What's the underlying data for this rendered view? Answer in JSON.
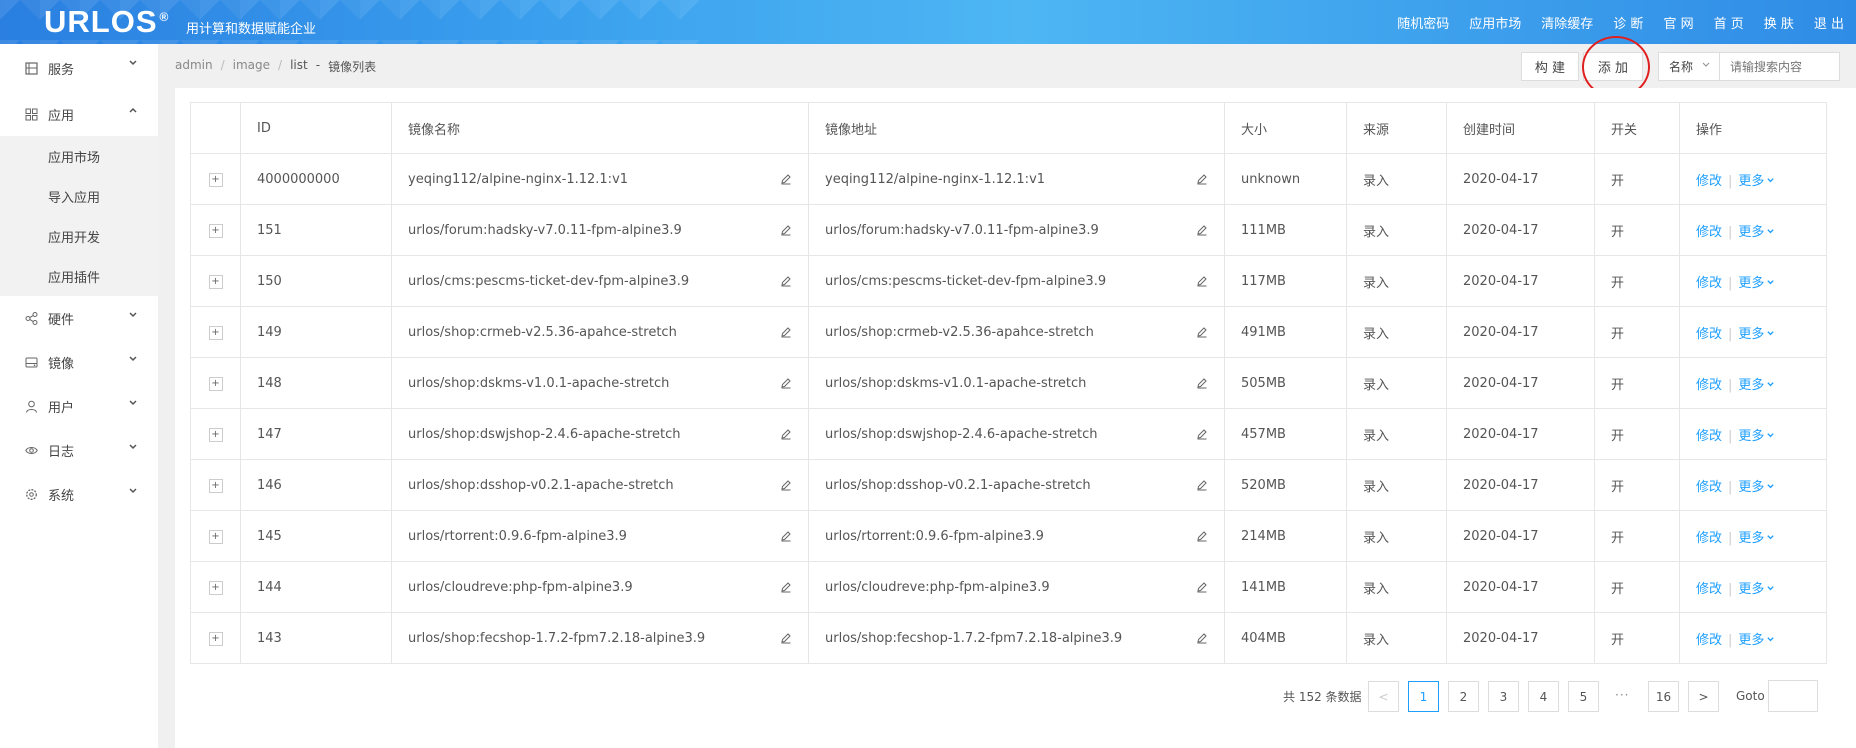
{
  "header": {
    "logo": "URLOS",
    "logo_mark": "®",
    "slogan": "用计算和数据赋能企业",
    "nav": [
      "随机密码",
      "应用市场",
      "清除缓存",
      "诊 断",
      "官 网",
      "首 页",
      "换 肤",
      "退 出"
    ]
  },
  "sidebar": {
    "items": [
      {
        "label": "服务",
        "icon": "server-icon"
      },
      {
        "label": "应用",
        "icon": "grid-icon"
      },
      {
        "label": "硬件",
        "icon": "share-icon"
      },
      {
        "label": "镜像",
        "icon": "disk-icon"
      },
      {
        "label": "用户",
        "icon": "user-icon"
      },
      {
        "label": "日志",
        "icon": "eye-icon"
      },
      {
        "label": "系统",
        "icon": "gear-icon"
      }
    ],
    "app_sub": [
      "应用市场",
      "导入应用",
      "应用开发",
      "应用插件"
    ]
  },
  "breadcrumb": {
    "a": "admin",
    "b": "image",
    "c": "list",
    "sep": "/",
    "dash": "-",
    "title": "镜像列表"
  },
  "toolbar": {
    "build": "构 建",
    "add": "添 加",
    "select_value": "名称",
    "search_placeholder": "请输搜索内容"
  },
  "table": {
    "columns": [
      "ID",
      "镜像名称",
      "镜像地址",
      "大小",
      "来源",
      "创建时间",
      "开关",
      "操作"
    ],
    "rows": [
      {
        "id": "4000000000",
        "name": "yeqing112/alpine-nginx-1.12.1:v1",
        "addr": "yeqing112/alpine-nginx-1.12.1:v1",
        "size": "unknown",
        "source": "录入",
        "created": "2020-04-17",
        "switch": "开"
      },
      {
        "id": "151",
        "name": "urlos/forum:hadsky-v7.0.11-fpm-alpine3.9",
        "addr": "urlos/forum:hadsky-v7.0.11-fpm-alpine3.9",
        "size": "111MB",
        "source": "录入",
        "created": "2020-04-17",
        "switch": "开"
      },
      {
        "id": "150",
        "name": "urlos/cms:pescms-ticket-dev-fpm-alpine3.9",
        "addr": "urlos/cms:pescms-ticket-dev-fpm-alpine3.9",
        "size": "117MB",
        "source": "录入",
        "created": "2020-04-17",
        "switch": "开"
      },
      {
        "id": "149",
        "name": "urlos/shop:crmeb-v2.5.36-apahce-stretch",
        "addr": "urlos/shop:crmeb-v2.5.36-apahce-stretch",
        "size": "491MB",
        "source": "录入",
        "created": "2020-04-17",
        "switch": "开"
      },
      {
        "id": "148",
        "name": "urlos/shop:dskms-v1.0.1-apache-stretch",
        "addr": "urlos/shop:dskms-v1.0.1-apache-stretch",
        "size": "505MB",
        "source": "录入",
        "created": "2020-04-17",
        "switch": "开"
      },
      {
        "id": "147",
        "name": "urlos/shop:dswjshop-2.4.6-apache-stretch",
        "addr": "urlos/shop:dswjshop-2.4.6-apache-stretch",
        "size": "457MB",
        "source": "录入",
        "created": "2020-04-17",
        "switch": "开"
      },
      {
        "id": "146",
        "name": "urlos/shop:dsshop-v0.2.1-apache-stretch",
        "addr": "urlos/shop:dsshop-v0.2.1-apache-stretch",
        "size": "520MB",
        "source": "录入",
        "created": "2020-04-17",
        "switch": "开"
      },
      {
        "id": "145",
        "name": "urlos/rtorrent:0.9.6-fpm-alpine3.9",
        "addr": "urlos/rtorrent:0.9.6-fpm-alpine3.9",
        "size": "214MB",
        "source": "录入",
        "created": "2020-04-17",
        "switch": "开"
      },
      {
        "id": "144",
        "name": "urlos/cloudreve:php-fpm-alpine3.9",
        "addr": "urlos/cloudreve:php-fpm-alpine3.9",
        "size": "141MB",
        "source": "录入",
        "created": "2020-04-17",
        "switch": "开"
      },
      {
        "id": "143",
        "name": "urlos/shop:fecshop-1.7.2-fpm7.2.18-alpine3.9",
        "addr": "urlos/shop:fecshop-1.7.2-fpm7.2.18-alpine3.9",
        "size": "404MB",
        "source": "录入",
        "created": "2020-04-17",
        "switch": "开"
      }
    ],
    "edit_label": "修改",
    "more_label": "更多",
    "expand_glyph": "+"
  },
  "pagination": {
    "total": "共 152 条数据",
    "pages": [
      "1",
      "2",
      "3",
      "4",
      "5"
    ],
    "last": "16",
    "ellipsis": "···",
    "current": "1",
    "goto_label": "Goto",
    "prev": "<",
    "next": ">"
  },
  "colors": {
    "accent": "#1e9fff",
    "header": "#3aa0ee",
    "highlight_circle": "#e02020"
  }
}
